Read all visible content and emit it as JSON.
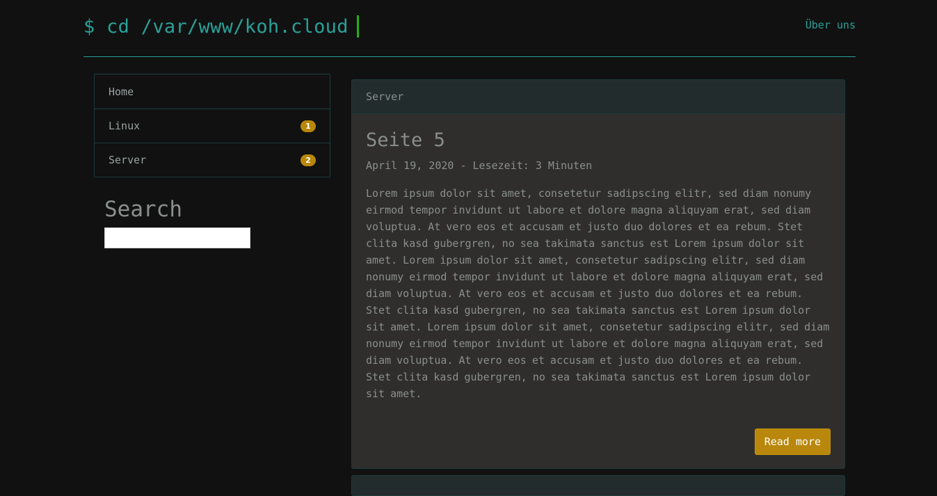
{
  "header": {
    "brand": "$ cd /var/www/koh.cloud",
    "link_about": "Über uns"
  },
  "sidebar": {
    "items": [
      {
        "label": "Home",
        "badge": ""
      },
      {
        "label": "Linux",
        "badge": "1"
      },
      {
        "label": "Server",
        "badge": "2"
      }
    ],
    "search_title": "Search",
    "search_value": ""
  },
  "post": {
    "category": "Server",
    "title": "Seite 5",
    "meta": "April 19, 2020 - Lesezeit: 3 Minuten",
    "text": "Lorem ipsum dolor sit amet, consetetur sadipscing elitr, sed diam nonumy eirmod tempor invidunt ut labore et dolore magna aliquyam erat, sed diam voluptua. At vero eos et accusam et justo duo dolores et ea rebum. Stet clita kasd gubergren, no sea takimata sanctus est Lorem ipsum dolor sit amet. Lorem ipsum dolor sit amet, consetetur sadipscing elitr, sed diam nonumy eirmod tempor invidunt ut labore et dolore magna aliquyam erat, sed diam voluptua. At vero eos et accusam et justo duo dolores et ea rebum. Stet clita kasd gubergren, no sea takimata sanctus est Lorem ipsum dolor sit amet. Lorem ipsum dolor sit amet, consetetur sadipscing elitr, sed diam nonumy eirmod tempor invidunt ut labore et dolore magna aliquyam erat, sed diam voluptua. At vero eos et accusam et justo duo dolores et ea rebum. Stet clita kasd gubergren, no sea takimata sanctus est Lorem ipsum dolor sit amet.",
    "read_more": "Read more"
  },
  "colors": {
    "background": "#111111",
    "accent_teal": "#2aa198",
    "cursor_green": "#22b014",
    "badge_gold": "#b8870b",
    "card_bg": "#2f2e2c",
    "card_header_bg": "#222c2d"
  }
}
